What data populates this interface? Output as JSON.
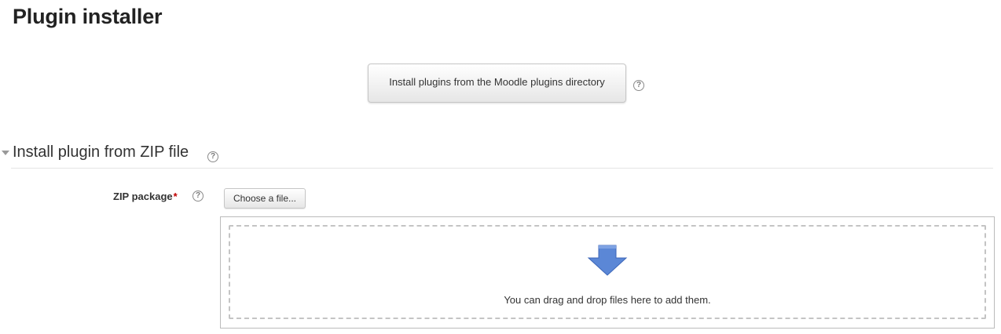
{
  "page": {
    "title": "Plugin installer"
  },
  "directory": {
    "button_label": "Install plugins from the Moodle plugins directory",
    "help_icon": "question-circle"
  },
  "zip_section": {
    "legend": "Install plugin from ZIP file",
    "collapse_icon": "triangle-down",
    "help_icon": "question-circle",
    "zip_field": {
      "label": "ZIP package",
      "required_marker": "*",
      "choose_file_label": "Choose a file...",
      "drop_message": "You can drag and drop files here to add them.",
      "drop_icon": "arrow-down"
    }
  },
  "colors": {
    "required": "#c00000",
    "arrow_fill": "#5b87d6",
    "arrow_shade": "#3c66b8"
  }
}
